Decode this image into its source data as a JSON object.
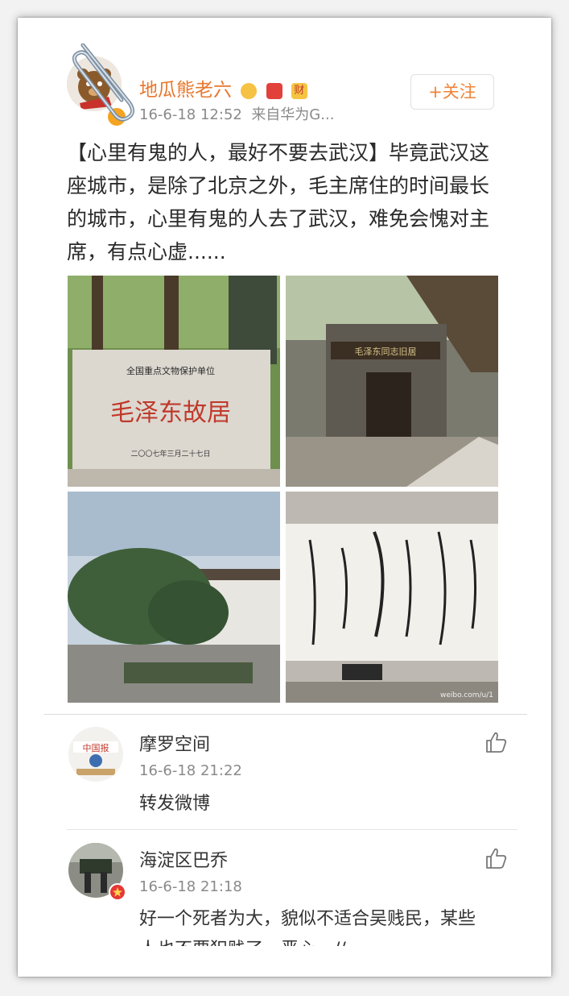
{
  "post": {
    "username": "地瓜熊老六",
    "badge_text": "财",
    "timestamp": "16-6-18 12:52",
    "source": "来自华为G...",
    "follow_label": "+关注",
    "text": "【心里有鬼的人，最好不要去武汉】毕竟武汉这座城市，是除了北京之外，毛主席住的时间最长的城市，心里有鬼的人去了武汉，难免会愧对主席，有点心虚......",
    "photos": [
      {
        "caption_top": "全国重点文物保护单位",
        "caption_main": "毛泽东故居",
        "caption_bottom": "二〇〇七年三月二十七日"
      },
      {
        "sign": "毛泽东同志旧居"
      },
      {},
      {
        "watermark": "weibo.com/u/1"
      }
    ]
  },
  "comments": [
    {
      "name": "摩罗空间",
      "time": "16-6-18 21:22",
      "text": "转发微博",
      "avatar_text": "中国报"
    },
    {
      "name": "海淀区巴乔",
      "time": "16-6-18 21:18",
      "text": "好一个死者为大，貌似不适合吴贱民，某些人也不要犯贱了。恶心。//"
    }
  ],
  "colors": {
    "accent": "#f08336",
    "username": "#e8772d",
    "meta": "#8a8a8a"
  },
  "icons": [
    "paperclip-icon",
    "verified-icon",
    "crown-icon",
    "red-packet-icon",
    "like-icon"
  ]
}
